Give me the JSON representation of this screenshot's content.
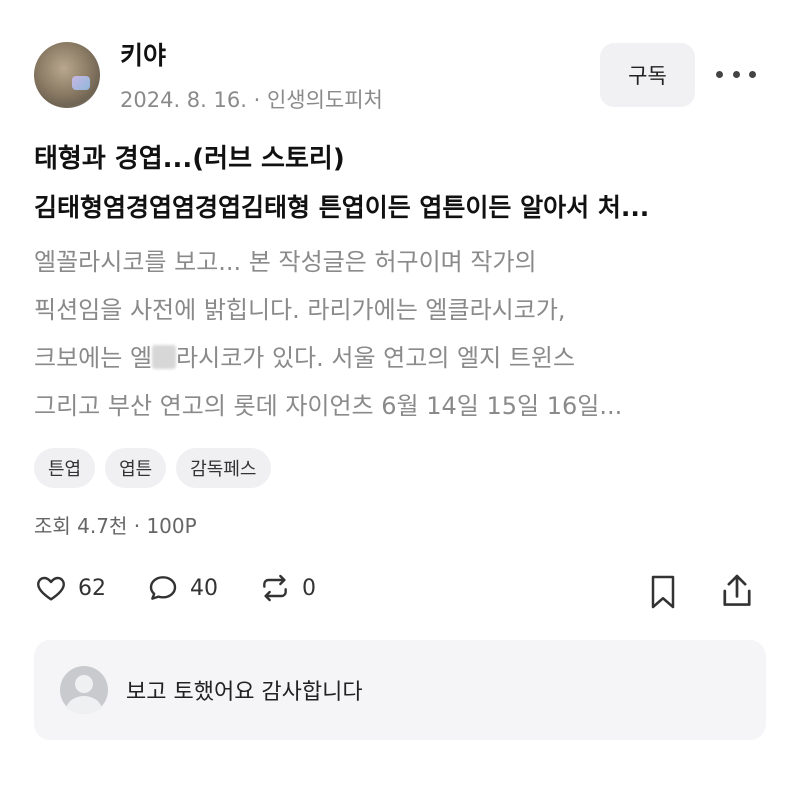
{
  "author": {
    "name": "키야",
    "date": "2024. 8. 16.",
    "separator": " · ",
    "category": "인생의도피처"
  },
  "header": {
    "subscribe_label": "구독",
    "more_icon": "more-horizontal-icon"
  },
  "post": {
    "title": "태형과 경엽...(러브 스토리)",
    "subtitle": "김태형염경엽염경엽김태형 튼엽이든 엽튼이든 알아서 처...",
    "body_lines": {
      "line1": "엘꼴라시코를 보고... 본 작성글은 허구이며 작가의",
      "line2": "픽션임을 사전에 밝힙니다. 라리가에는 엘클라시코가,",
      "line3_before": "크보에는 엘",
      "line3_after": "라시코가 있다. 서울 연고의 엘지 트윈스",
      "line4": "그리고  부산 연고의 롯데 자이언츠 6월 14일 15일 16일..."
    }
  },
  "tags": [
    "튼엽",
    "엽튼",
    "감독페스"
  ],
  "stats": {
    "views": "조회 4.7천",
    "separator": " · ",
    "points": "100P"
  },
  "actions": {
    "likes": "62",
    "comments": "40",
    "reposts": "0"
  },
  "comment_preview": {
    "text": "보고 토했어요 감사합니다"
  },
  "colors": {
    "text_primary": "#111111",
    "text_secondary": "#8a8a8a",
    "chip_bg": "#f0f0f2",
    "comment_bg": "#f5f5f7"
  }
}
